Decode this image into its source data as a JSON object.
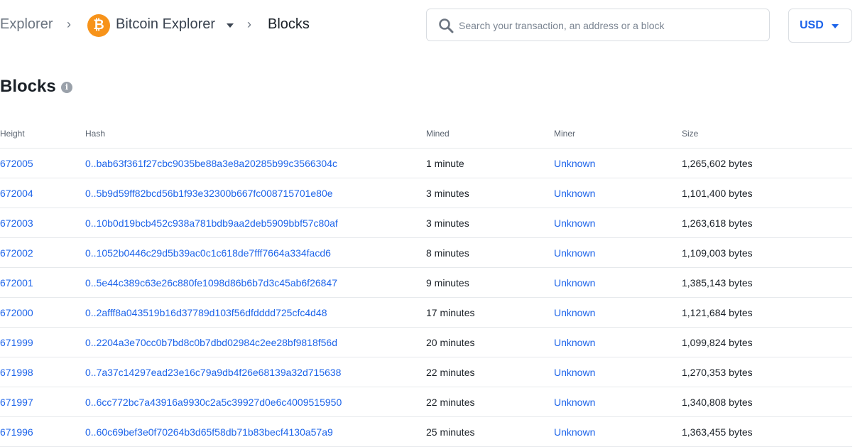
{
  "breadcrumb": {
    "root": "Explorer",
    "separator": "›",
    "network": "Bitcoin Explorer",
    "current": "Blocks"
  },
  "icons": {
    "logo": "bitcoin-icon",
    "search": "search-icon",
    "info": "info-icon"
  },
  "logo_glyph": "₿",
  "search": {
    "placeholder": "Search your transaction, an address or a block",
    "value": ""
  },
  "currency": {
    "selected": "USD"
  },
  "page": {
    "title": "Blocks",
    "info_glyph": "i"
  },
  "colors": {
    "accent": "#1d64ea",
    "bitcoin": "#f7931a",
    "border": "#e6e9ec"
  },
  "table": {
    "headers": [
      "Height",
      "Hash",
      "Mined",
      "Miner",
      "Size"
    ],
    "rows": [
      {
        "height": "672005",
        "hash": "0..bab63f361f27cbc9035be88a3e8a20285b99c3566304c",
        "mined": "1 minute",
        "miner": "Unknown",
        "size": "1,265,602 bytes"
      },
      {
        "height": "672004",
        "hash": "0..5b9d59ff82bcd56b1f93e32300b667fc008715701e80e",
        "mined": "3 minutes",
        "miner": "Unknown",
        "size": "1,101,400 bytes"
      },
      {
        "height": "672003",
        "hash": "0..10b0d19bcb452c938a781bdb9aa2deb5909bbf57c80af",
        "mined": "3 minutes",
        "miner": "Unknown",
        "size": "1,263,618 bytes"
      },
      {
        "height": "672002",
        "hash": "0..1052b0446c29d5b39ac0c1c618de7fff7664a334facd6",
        "mined": "8 minutes",
        "miner": "Unknown",
        "size": "1,109,003 bytes"
      },
      {
        "height": "672001",
        "hash": "0..5e44c389c63e26c880fe1098d86b6b7d3c45ab6f26847",
        "mined": "9 minutes",
        "miner": "Unknown",
        "size": "1,385,143 bytes"
      },
      {
        "height": "672000",
        "hash": "0..2afff8a043519b16d37789d103f56dfdddd725cfc4d48",
        "mined": "17 minutes",
        "miner": "Unknown",
        "size": "1,121,684 bytes"
      },
      {
        "height": "671999",
        "hash": "0..2204a3e70cc0b7bd8c0b7dbd02984c2ee28bf9818f56d",
        "mined": "20 minutes",
        "miner": "Unknown",
        "size": "1,099,824 bytes"
      },
      {
        "height": "671998",
        "hash": "0..7a37c14297ead23e16c79a9db4f26e68139a32d715638",
        "mined": "22 minutes",
        "miner": "Unknown",
        "size": "1,270,353 bytes"
      },
      {
        "height": "671997",
        "hash": "0..6cc772bc7a43916a9930c2a5c39927d0e6c4009515950",
        "mined": "22 minutes",
        "miner": "Unknown",
        "size": "1,340,808 bytes"
      },
      {
        "height": "671996",
        "hash": "0..60c69bef3e0f70264b3d65f58db71b83becf4130a57a9",
        "mined": "25 minutes",
        "miner": "Unknown",
        "size": "1,363,455 bytes"
      }
    ]
  }
}
